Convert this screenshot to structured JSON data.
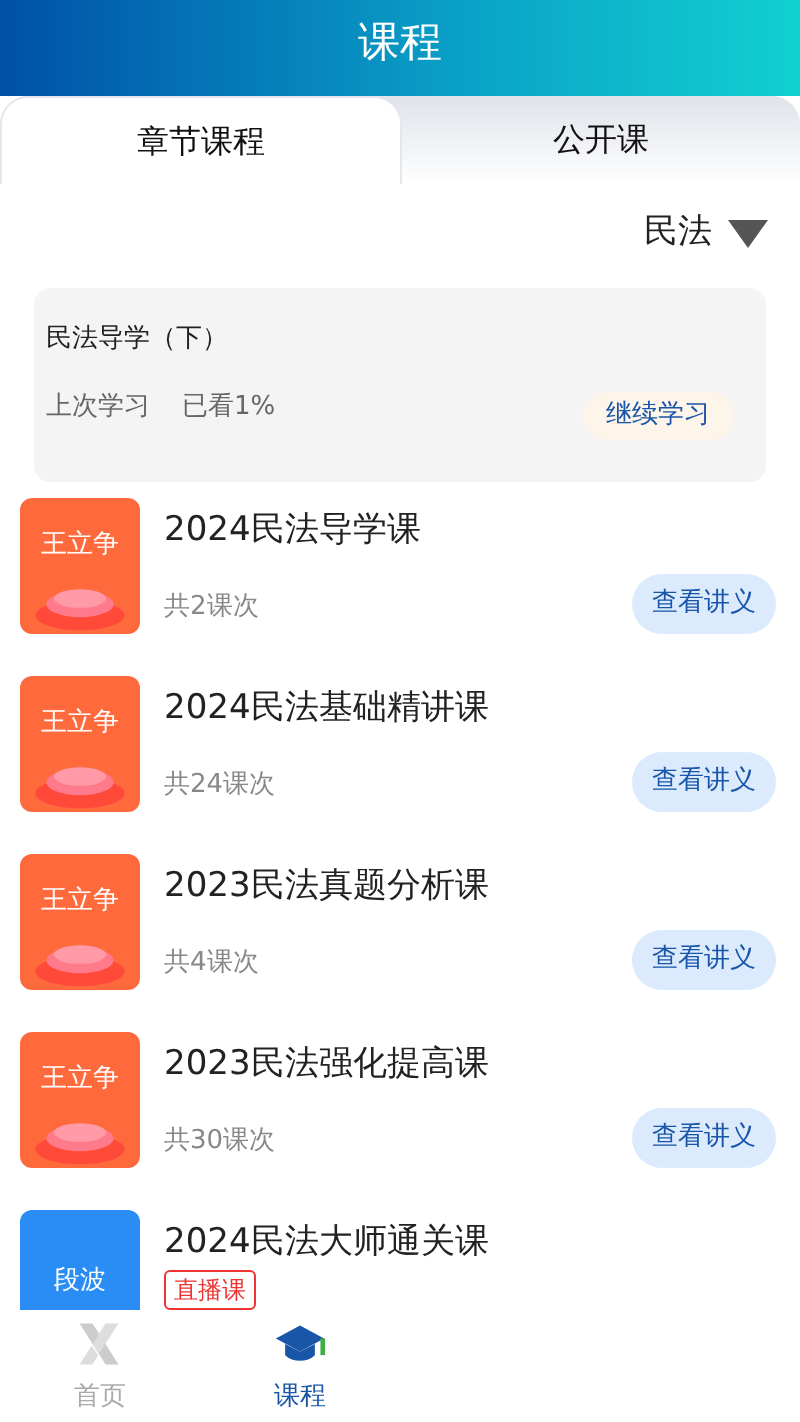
{
  "header": {
    "title": "课程"
  },
  "tabs": [
    {
      "label": "章节课程",
      "selected": true
    },
    {
      "label": "公开课",
      "selected": false
    }
  ],
  "filter": {
    "value": "民法"
  },
  "continue_card": {
    "title": "民法导学（下）",
    "last_label": "上次学习",
    "progress": "已看1%",
    "button": "继续学习"
  },
  "courses": [
    {
      "kind": "recorded",
      "teacher": "王立争",
      "color": "#ff6a3d",
      "title": "2024民法导学课",
      "count": "共2课次",
      "button": "查看讲义"
    },
    {
      "kind": "recorded",
      "teacher": "王立争",
      "color": "#ff6a3d",
      "title": "2024民法基础精讲课",
      "count": "共24课次",
      "button": "查看讲义"
    },
    {
      "kind": "recorded",
      "teacher": "王立争",
      "color": "#ff6a3d",
      "title": "2023民法真题分析课",
      "count": "共4课次",
      "button": "查看讲义"
    },
    {
      "kind": "recorded",
      "teacher": "王立争",
      "color": "#ff6a3d",
      "title": "2023民法强化提高课",
      "count": "共30课次",
      "button": "查看讲义"
    },
    {
      "kind": "live",
      "teacher": "段波",
      "color": "#2a8cf5",
      "title": "2024民法大师通关课",
      "tag": "直播课"
    }
  ],
  "bottom_nav": [
    {
      "label": "首页",
      "selected": false
    },
    {
      "label": "课程",
      "selected": true
    }
  ]
}
